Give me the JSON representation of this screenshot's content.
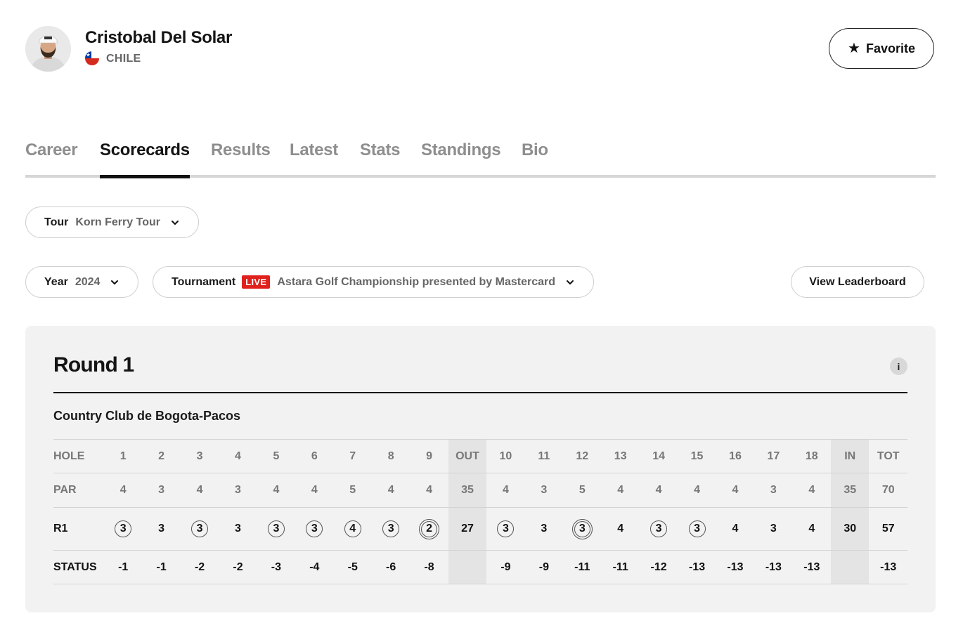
{
  "player": {
    "name": "Cristobal Del Solar",
    "country": "CHILE"
  },
  "favorite": {
    "label": "Favorite",
    "icon": "star-icon"
  },
  "tabs": [
    {
      "label": "Career",
      "active": false
    },
    {
      "label": "Scorecards",
      "active": true
    },
    {
      "label": "Results",
      "active": false
    },
    {
      "label": "Latest",
      "active": false
    },
    {
      "label": "Stats",
      "active": false
    },
    {
      "label": "Standings",
      "active": false
    },
    {
      "label": "Bio",
      "active": false
    }
  ],
  "filters": {
    "tour": {
      "label": "Tour",
      "value": "Korn Ferry Tour"
    },
    "year": {
      "label": "Year",
      "value": "2024"
    },
    "tournament": {
      "label": "Tournament",
      "badge": "LIVE",
      "value": "Astara Golf Championship presented by Mastercard"
    }
  },
  "view_leaderboard": "View Leaderboard",
  "scorecard": {
    "round_title": "Round 1",
    "info_label": "i",
    "course": "Country Club de Bogota-Pacos",
    "rows": [
      {
        "label": "HOLE",
        "type": "header",
        "cells": [
          "1",
          "2",
          "3",
          "4",
          "5",
          "6",
          "7",
          "8",
          "9",
          "OUT",
          "10",
          "11",
          "12",
          "13",
          "14",
          "15",
          "16",
          "17",
          "18",
          "IN",
          "TOT"
        ]
      },
      {
        "label": "PAR",
        "type": "par",
        "cells": [
          "4",
          "3",
          "4",
          "3",
          "4",
          "4",
          "5",
          "4",
          "4",
          "35",
          "4",
          "3",
          "5",
          "4",
          "4",
          "4",
          "4",
          "3",
          "4",
          "35",
          "70"
        ]
      },
      {
        "label": "R1",
        "type": "score",
        "cells": [
          "3",
          "3",
          "3",
          "3",
          "3",
          "3",
          "4",
          "3",
          "2",
          "27",
          "3",
          "3",
          "3",
          "4",
          "3",
          "3",
          "4",
          "3",
          "4",
          "30",
          "57"
        ],
        "marks": [
          "birdie",
          "",
          "birdie",
          "",
          "birdie",
          "birdie",
          "birdie",
          "birdie",
          "eagle",
          "",
          "birdie",
          "",
          "eagle",
          "",
          "birdie",
          "birdie",
          "",
          "",
          "",
          "",
          ""
        ]
      },
      {
        "label": "STATUS",
        "type": "status",
        "cells": [
          "-1",
          "-1",
          "-2",
          "-2",
          "-3",
          "-4",
          "-5",
          "-6",
          "-8",
          "",
          "-9",
          "-9",
          "-11",
          "-11",
          "-12",
          "-13",
          "-13",
          "-13",
          "-13",
          "",
          "-13"
        ]
      }
    ]
  },
  "colors": {
    "live_badge": "#e0201c",
    "panel_bg": "#f2f2f2",
    "subtotal_bg": "#e4e4e4",
    "active_tab": "#141414",
    "inactive_tab": "#8e8e8e"
  }
}
